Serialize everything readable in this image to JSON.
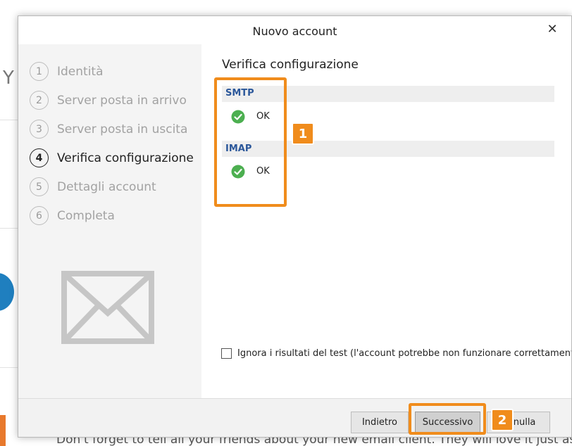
{
  "background": {
    "partial_letter": "Y",
    "right_text": "n",
    "bottom_text": "Don't forget to tell all your friends about your new email client. They will love it just as mu"
  },
  "dialog": {
    "title": "Nuovo account",
    "close_symbol": "✕"
  },
  "steps": [
    {
      "number": "1",
      "label": "Identità",
      "active": false
    },
    {
      "number": "2",
      "label": "Server posta in arrivo",
      "active": false
    },
    {
      "number": "3",
      "label": "Server posta in uscita",
      "active": false
    },
    {
      "number": "4",
      "label": "Verifica configurazione",
      "active": true
    },
    {
      "number": "5",
      "label": "Dettagli account",
      "active": false
    },
    {
      "number": "6",
      "label": "Completa",
      "active": false
    }
  ],
  "left_icon": "mail-envelope-icon",
  "main": {
    "section_title": "Verifica configurazione",
    "tests": [
      {
        "name": "SMTP",
        "status": "OK",
        "status_icon": "check-circle-icon"
      },
      {
        "name": "IMAP",
        "status": "OK",
        "status_icon": "check-circle-icon"
      }
    ],
    "ignore_checkbox": {
      "checked": false,
      "label": "Ignora i risultati del test (l'account potrebbe non funzionare correttamente)."
    }
  },
  "footer": {
    "back_label": "Indietro",
    "next_label": "Successivo",
    "cancel_label": "Annulla"
  },
  "annotations": [
    "1",
    "2"
  ],
  "colors": {
    "accent_orange": "#f08c1c",
    "check_green": "#4caf50",
    "link_blue": "#2b579a"
  }
}
